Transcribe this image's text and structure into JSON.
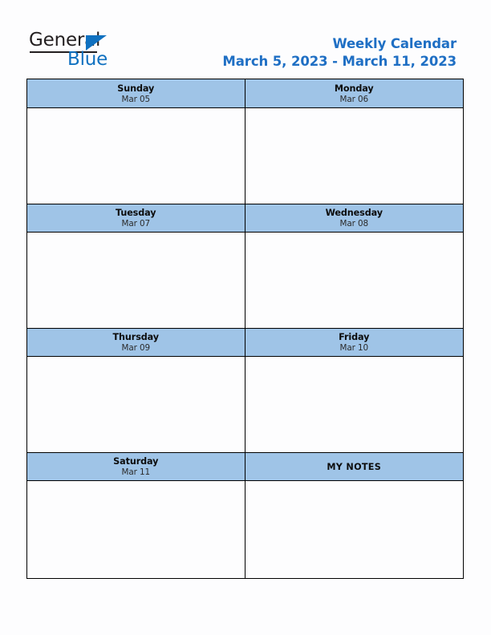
{
  "brand": {
    "word_one": "General",
    "word_two": "Blue",
    "triangle_icon": "triangle-icon",
    "color_dark": "#231f20",
    "color_blue": "#1071c0"
  },
  "header": {
    "title": "Weekly Calendar",
    "date_range": "March 5, 2023 - March 11, 2023",
    "title_color": "#1f6fc4"
  },
  "calendar": {
    "header_bg": "#9fc4e7",
    "border_color": "#000000",
    "rows": [
      {
        "left": {
          "name": "Sunday",
          "date": "Mar 05"
        },
        "right": {
          "name": "Monday",
          "date": "Mar 06"
        }
      },
      {
        "left": {
          "name": "Tuesday",
          "date": "Mar 07"
        },
        "right": {
          "name": "Wednesday",
          "date": "Mar 08"
        }
      },
      {
        "left": {
          "name": "Thursday",
          "date": "Mar 09"
        },
        "right": {
          "name": "Friday",
          "date": "Mar 10"
        }
      },
      {
        "left": {
          "name": "Saturday",
          "date": "Mar 11"
        },
        "right": {
          "name": "MY NOTES",
          "date": ""
        }
      }
    ]
  }
}
